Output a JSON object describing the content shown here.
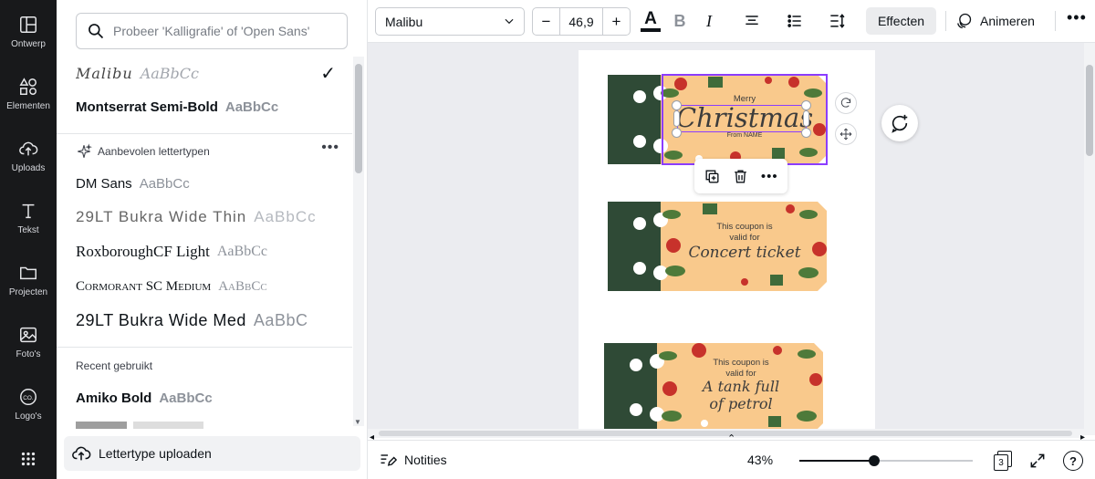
{
  "rail": {
    "items": [
      {
        "label": "Ontwerp",
        "icon": "layout-icon"
      },
      {
        "label": "Elementen",
        "icon": "shapes-icon"
      },
      {
        "label": "Uploads",
        "icon": "upload-cloud-icon"
      },
      {
        "label": "Tekst",
        "icon": "text-icon"
      },
      {
        "label": "Projecten",
        "icon": "folder-icon"
      },
      {
        "label": "Foto's",
        "icon": "image-icon"
      },
      {
        "label": "Logo's",
        "icon": "co-logo-icon"
      },
      {
        "label": "",
        "icon": "apps-grid-icon"
      }
    ]
  },
  "font_panel": {
    "search_placeholder": "Probeer 'Kalligrafie' of 'Open Sans'",
    "top_fonts": [
      {
        "name": "Malibu",
        "sample": "AaBbCc",
        "selected": true
      },
      {
        "name": "Montserrat Semi-Bold",
        "sample": "AaBbCc",
        "selected": false
      }
    ],
    "recommended_heading": "Aanbevolen lettertypen",
    "recommended": [
      {
        "name": "DM Sans",
        "sample": "AaBbCc"
      },
      {
        "name": "29LT Bukra Wide Thin",
        "sample": "AaBbCc"
      },
      {
        "name": "RoxboroughCF Light",
        "sample": "AaBbCc"
      },
      {
        "name": "Cormorant SC Medium",
        "sample": "AaBbCc"
      },
      {
        "name": "29LT Bukra Wide Med",
        "sample": "AaBbC"
      }
    ],
    "recent_heading": "Recent gebruikt",
    "recent": [
      {
        "name": "Amiko Bold",
        "sample": "AaBbCc"
      }
    ],
    "upload_label": "Lettertype uploaden"
  },
  "toolbar": {
    "font_name": "Malibu",
    "font_size": "46,9",
    "minus": "−",
    "plus": "+",
    "text_color_glyph": "A",
    "bold_glyph": "B",
    "italic_glyph": "I",
    "effects_label": "Effecten",
    "animate_label": "Animeren",
    "more_glyph": "•••"
  },
  "canvas": {
    "tickets": [
      {
        "lines": [
          "Merry"
        ],
        "script": "Christmas",
        "footer": "From NAME"
      },
      {
        "lines": [
          "This coupon is",
          "valid for"
        ],
        "script": "Concert ticket",
        "footer": ""
      },
      {
        "lines": [
          "This coupon is",
          "valid for"
        ],
        "script": "A tank full of petrol",
        "footer": ""
      }
    ],
    "colors": {
      "stub": "#2f4a36",
      "ticket_bg": "#f9c98c",
      "selection": "#8b3dff"
    }
  },
  "bottombar": {
    "notes_label": "Notities",
    "zoom": "43%",
    "zoom_fraction": 0.43,
    "page_count": "3",
    "help_glyph": "?"
  }
}
